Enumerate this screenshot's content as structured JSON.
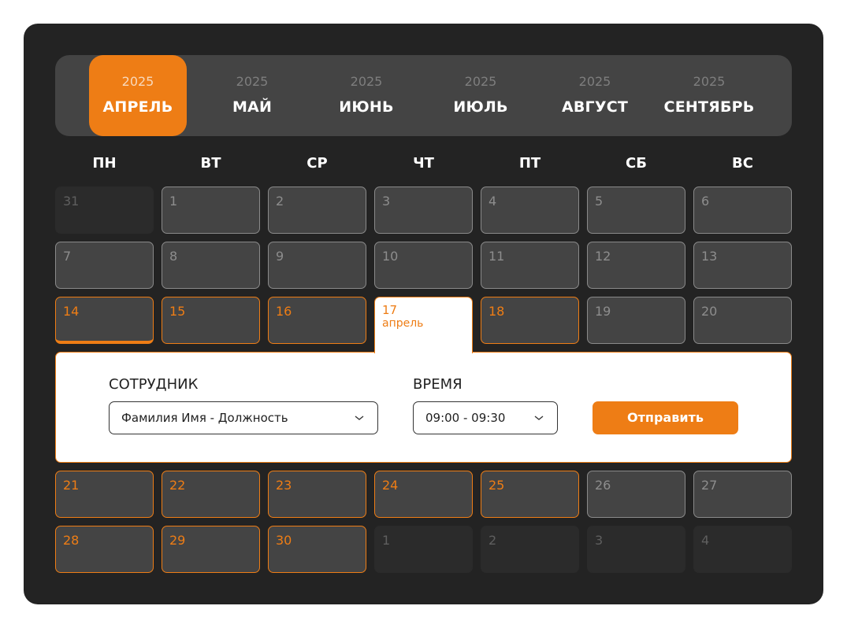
{
  "months": [
    {
      "year": "2025",
      "name": "АПРЕЛЬ",
      "active": true
    },
    {
      "year": "2025",
      "name": "МАЙ"
    },
    {
      "year": "2025",
      "name": "ИЮНЬ"
    },
    {
      "year": "2025",
      "name": "ИЮЛЬ"
    },
    {
      "year": "2025",
      "name": "АВГУСТ"
    },
    {
      "year": "2025",
      "name": "СЕНТЯБРЬ"
    }
  ],
  "weekdays": [
    "ПН",
    "ВТ",
    "СР",
    "ЧТ",
    "ПТ",
    "СБ",
    "ВС"
  ],
  "days": [
    {
      "n": "31",
      "state": "outside"
    },
    {
      "n": "1",
      "state": "past"
    },
    {
      "n": "2",
      "state": "past"
    },
    {
      "n": "3",
      "state": "past"
    },
    {
      "n": "4",
      "state": "past"
    },
    {
      "n": "5",
      "state": "past"
    },
    {
      "n": "6",
      "state": "past"
    },
    {
      "n": "7",
      "state": "past"
    },
    {
      "n": "8",
      "state": "past"
    },
    {
      "n": "9",
      "state": "past"
    },
    {
      "n": "10",
      "state": "past"
    },
    {
      "n": "11",
      "state": "past"
    },
    {
      "n": "12",
      "state": "past"
    },
    {
      "n": "13",
      "state": "past"
    },
    {
      "n": "14",
      "state": "today"
    },
    {
      "n": "15",
      "state": "avail"
    },
    {
      "n": "16",
      "state": "avail"
    },
    {
      "n": "17",
      "state": "selected",
      "sub": "апрель"
    },
    {
      "n": "18",
      "state": "avail"
    },
    {
      "n": "19",
      "state": "past"
    },
    {
      "n": "20",
      "state": "past"
    },
    {
      "n": "21",
      "state": "avail"
    },
    {
      "n": "22",
      "state": "avail"
    },
    {
      "n": "23",
      "state": "avail"
    },
    {
      "n": "24",
      "state": "avail"
    },
    {
      "n": "25",
      "state": "avail"
    },
    {
      "n": "26",
      "state": "past"
    },
    {
      "n": "27",
      "state": "past"
    },
    {
      "n": "28",
      "state": "avail"
    },
    {
      "n": "29",
      "state": "avail"
    },
    {
      "n": "30",
      "state": "avail"
    },
    {
      "n": "1",
      "state": "outside"
    },
    {
      "n": "2",
      "state": "outside"
    },
    {
      "n": "3",
      "state": "outside"
    },
    {
      "n": "4",
      "state": "outside"
    }
  ],
  "form": {
    "employee_label": "СОТРУДНИК",
    "employee_value": "Фамилия Имя - Должность",
    "time_label": "ВРЕМЯ",
    "time_value": "09:00 - 09:30",
    "submit_label": "Отправить"
  },
  "colors": {
    "accent": "#ee7d15",
    "panel": "#232323",
    "cell": "#444444"
  },
  "icons": {
    "dropdown": "chevron-down-icon"
  }
}
